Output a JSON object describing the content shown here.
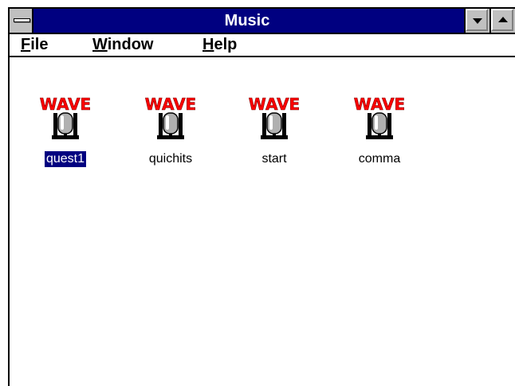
{
  "window": {
    "title": "Music"
  },
  "menu": {
    "file": {
      "accel": "F",
      "rest": "ile"
    },
    "window": {
      "accel": "W",
      "rest": "indow"
    },
    "help": {
      "accel": "H",
      "rest": "elp"
    }
  },
  "icons": [
    {
      "badge": "WAVE",
      "label": "quest1",
      "selected": true,
      "icon": "wave-microphone-icon"
    },
    {
      "badge": "WAVE",
      "label": "quichits",
      "selected": false,
      "icon": "wave-microphone-icon"
    },
    {
      "badge": "WAVE",
      "label": "start",
      "selected": false,
      "icon": "wave-microphone-icon"
    },
    {
      "badge": "WAVE",
      "label": "comma",
      "selected": false,
      "icon": "wave-microphone-icon"
    }
  ],
  "colors": {
    "titlebar": "#000080",
    "selection": "#000080",
    "wave_text": "#ff0000"
  }
}
